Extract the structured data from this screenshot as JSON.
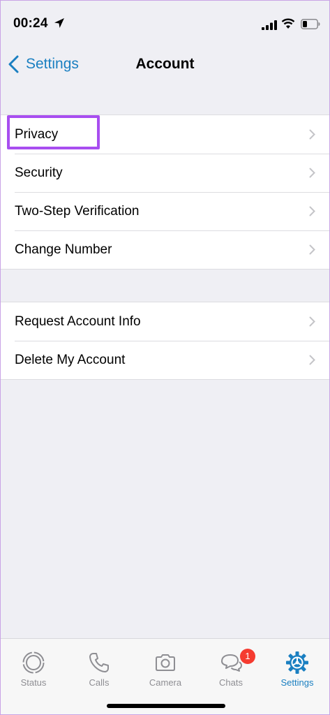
{
  "status_bar": {
    "time": "00:24"
  },
  "nav": {
    "back_label": "Settings",
    "title": "Account"
  },
  "groups": [
    {
      "items": [
        {
          "label": "Privacy"
        },
        {
          "label": "Security"
        },
        {
          "label": "Two-Step Verification"
        },
        {
          "label": "Change Number"
        }
      ]
    },
    {
      "items": [
        {
          "label": "Request Account Info"
        },
        {
          "label": "Delete My Account"
        }
      ]
    }
  ],
  "tabs": [
    {
      "label": "Status",
      "icon": "status-icon"
    },
    {
      "label": "Calls",
      "icon": "phone-icon"
    },
    {
      "label": "Camera",
      "icon": "camera-icon"
    },
    {
      "label": "Chats",
      "icon": "chat-bubbles-icon",
      "badge": "1"
    },
    {
      "label": "Settings",
      "icon": "gear-icon",
      "active": true
    }
  ],
  "colors": {
    "accent": "#1a7fc1",
    "highlight": "#a84ef0",
    "badge": "#f53b30",
    "background": "#efeff4"
  }
}
